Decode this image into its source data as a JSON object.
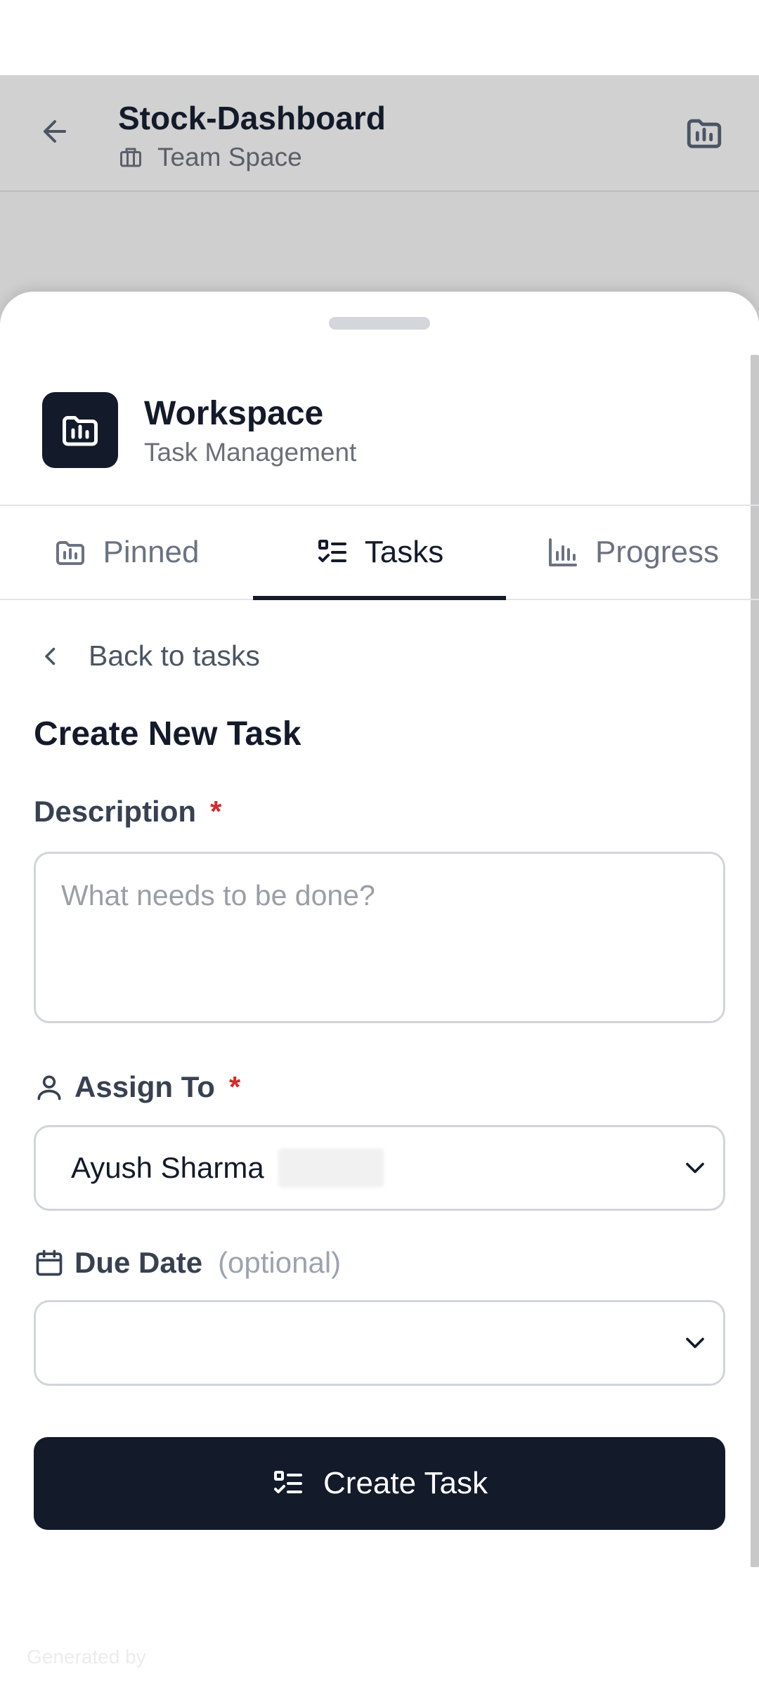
{
  "header": {
    "title": "Stock-Dashboard",
    "subtitle": "Team Space",
    "back_icon": "arrow-left-icon",
    "action_icon": "folder-chart-icon"
  },
  "workspace": {
    "title": "Workspace",
    "subtitle": "Task Management",
    "icon": "folder-chart-icon"
  },
  "tabs": [
    {
      "label": "Pinned",
      "icon": "folder-chart-icon",
      "active": false
    },
    {
      "label": "Tasks",
      "icon": "checklist-icon",
      "active": true
    },
    {
      "label": "Progress",
      "icon": "bar-chart-icon",
      "active": false
    }
  ],
  "form": {
    "back_label": "Back to tasks",
    "title": "Create New Task",
    "description": {
      "label": "Description",
      "required_mark": "*",
      "placeholder": "What needs to be done?",
      "value": ""
    },
    "assign": {
      "label": "Assign To",
      "required_mark": "*",
      "value": "Ayush Sharma"
    },
    "due_date": {
      "label": "Due Date",
      "optional_label": "(optional)",
      "value": ""
    },
    "submit_label": "Create Task"
  },
  "footer": {
    "generated_text": "Generated by"
  },
  "colors": {
    "primary": "#131a2a",
    "required": "#d12b2b",
    "muted": "#6b7280",
    "overlay": "#d1d1d1"
  }
}
